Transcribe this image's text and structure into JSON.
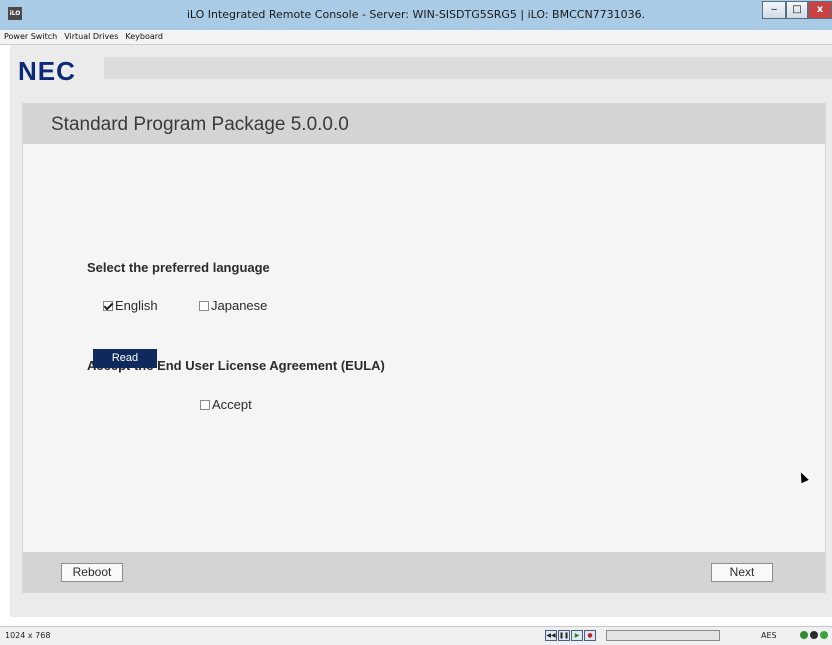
{
  "window": {
    "title": "iLO Integrated Remote Console - Server: WIN-SISDTG5SRG5 | iLO: BMCCN7731036.",
    "app_icon_label": "iLO",
    "min_label": "‒",
    "max_label": "□",
    "close_label": "x"
  },
  "menu": {
    "items": [
      "Power Switch",
      "Virtual Drives",
      "Keyboard"
    ]
  },
  "remote": {
    "logo": "NEC",
    "header_title": "Standard Program Package 5.0.0.0",
    "language_heading": "Select the preferred language",
    "english_label": "English",
    "english_checked": true,
    "japanese_label": "Japanese",
    "japanese_checked": false,
    "eula_heading": "Accept the End User License Agreement (EULA)",
    "read_label": "Read",
    "accept_label": "Accept",
    "accept_checked": false,
    "reboot_label": "Reboot",
    "next_label": "Next"
  },
  "statusbar": {
    "resolution": "1024 x 768",
    "encryption": "AES",
    "indicator_colors": [
      "#2e8b2e",
      "#2b2b2b",
      "#3aa33a"
    ]
  },
  "colors": {
    "titlebar": "#a9cbe6",
    "logo": "#0b2a7a",
    "read_button": "#0e2a5c"
  }
}
